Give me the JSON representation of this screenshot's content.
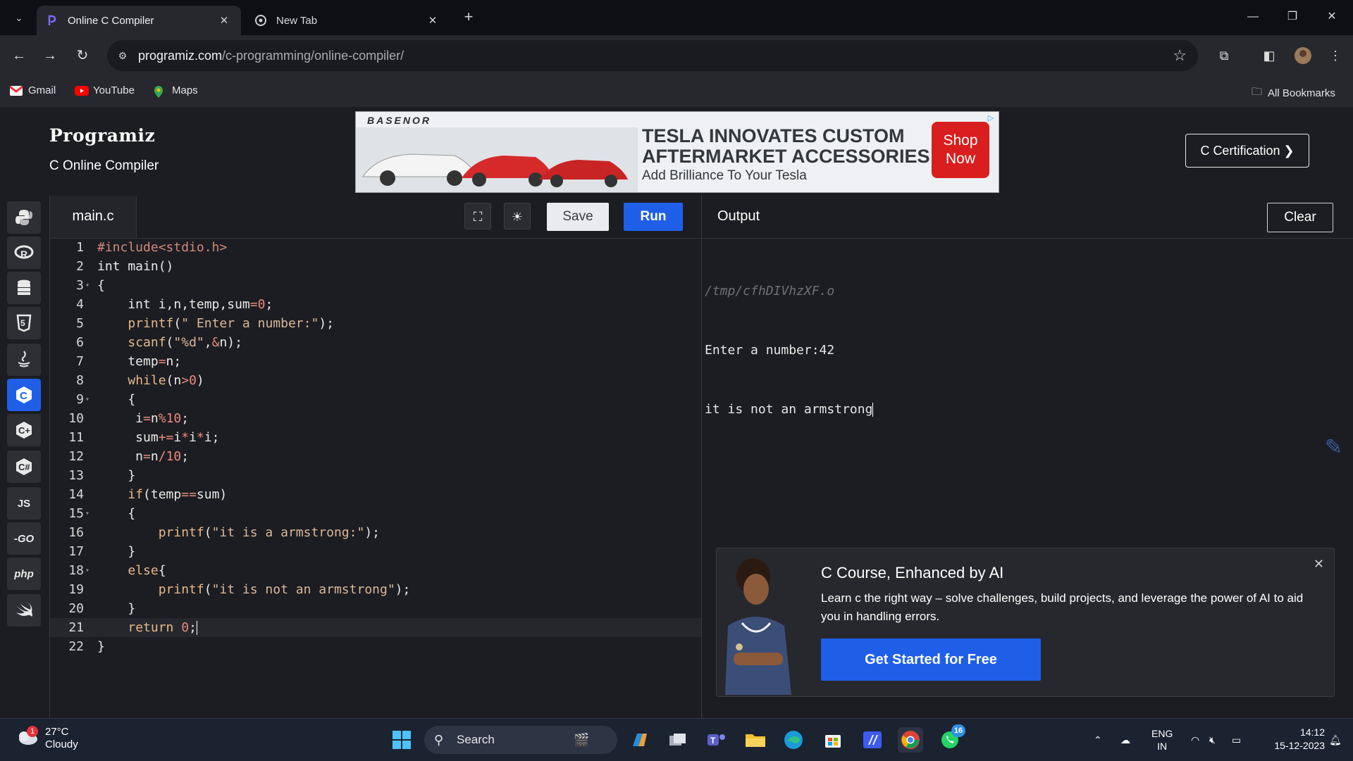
{
  "browser": {
    "tabs": [
      {
        "title": "Online C Compiler",
        "active": true
      },
      {
        "title": "New Tab",
        "active": false
      }
    ],
    "url_host": "programiz.com",
    "url_path": "/c-programming/online-compiler/",
    "bookmarks": [
      "Gmail",
      "YouTube",
      "Maps"
    ],
    "all_bookmarks": "All Bookmarks"
  },
  "header": {
    "logo": "Programiz",
    "subtitle": "C Online Compiler",
    "cert_button": "C Certification ❯"
  },
  "ad": {
    "brand": "BASENOR",
    "headline_1": "TESLA INNOVATES CUSTOM",
    "headline_2": "AFTERMARKET ACCESSORIES",
    "tagline": "Add Brilliance To Your Tesla",
    "shop_1": "Shop",
    "shop_2": "Now"
  },
  "sidebar": {
    "languages": [
      "python",
      "r",
      "sql",
      "html",
      "java",
      "c",
      "c++",
      "c#",
      "JS",
      "GO",
      "php",
      "swift"
    ],
    "active": "c",
    "labels": {
      "js": "JS",
      "go": "-GO",
      "php": "php"
    }
  },
  "editor": {
    "filename": "main.c",
    "save_label": "Save",
    "run_label": "Run",
    "current_line": 21
  },
  "output": {
    "title": "Output",
    "clear_label": "Clear",
    "tmp_path": "/tmp/cfhDIVhzXF.o",
    "lines": [
      "Enter a number:42",
      "it is not an armstrong"
    ]
  },
  "promo": {
    "title": "C Course, Enhanced by AI",
    "body": "Learn c the right way – solve challenges, build projects, and leverage the power of AI to aid you in handling errors.",
    "button": "Get Started for Free"
  },
  "taskbar": {
    "temperature": "27°C",
    "condition": "Cloudy",
    "weather_badge": "1",
    "search": "Search",
    "whatsapp_badge": "16",
    "lang_1": "ENG",
    "lang_2": "IN",
    "time": "14:12",
    "date": "15-12-2023"
  },
  "colors": {
    "accent": "#1f5fe8",
    "background": "#1c1d22",
    "chrome": "#26282d"
  }
}
